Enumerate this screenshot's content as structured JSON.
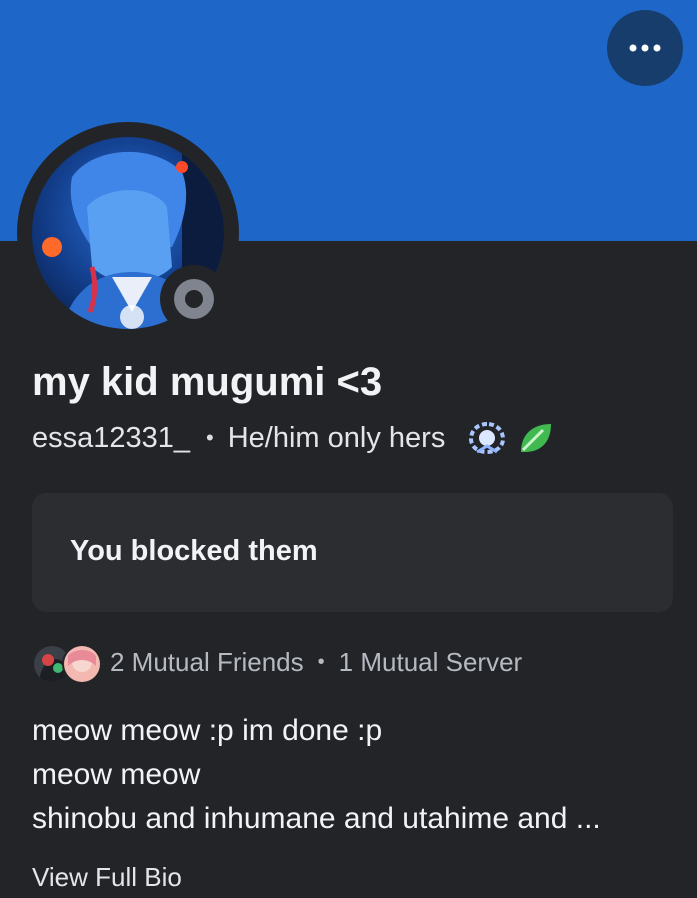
{
  "profile": {
    "display_name": "my kid mugumi <3",
    "username": "essa12331_",
    "pronouns": "He/him only hers",
    "status": "offline",
    "badges": [
      "laurel-badge-icon",
      "leaf-badge-icon"
    ]
  },
  "banner": {
    "color": "#1e66c7"
  },
  "blocked_notice": {
    "text": "You blocked them"
  },
  "mutuals": {
    "friends_label": "2 Mutual Friends",
    "servers_label": "1 Mutual Server"
  },
  "bio": {
    "lines": [
      "meow meow :p im done :p",
      "meow meow",
      "shinobu and inhumane and utahime and ..."
    ],
    "view_full_label": "View Full Bio"
  },
  "separator": "•"
}
